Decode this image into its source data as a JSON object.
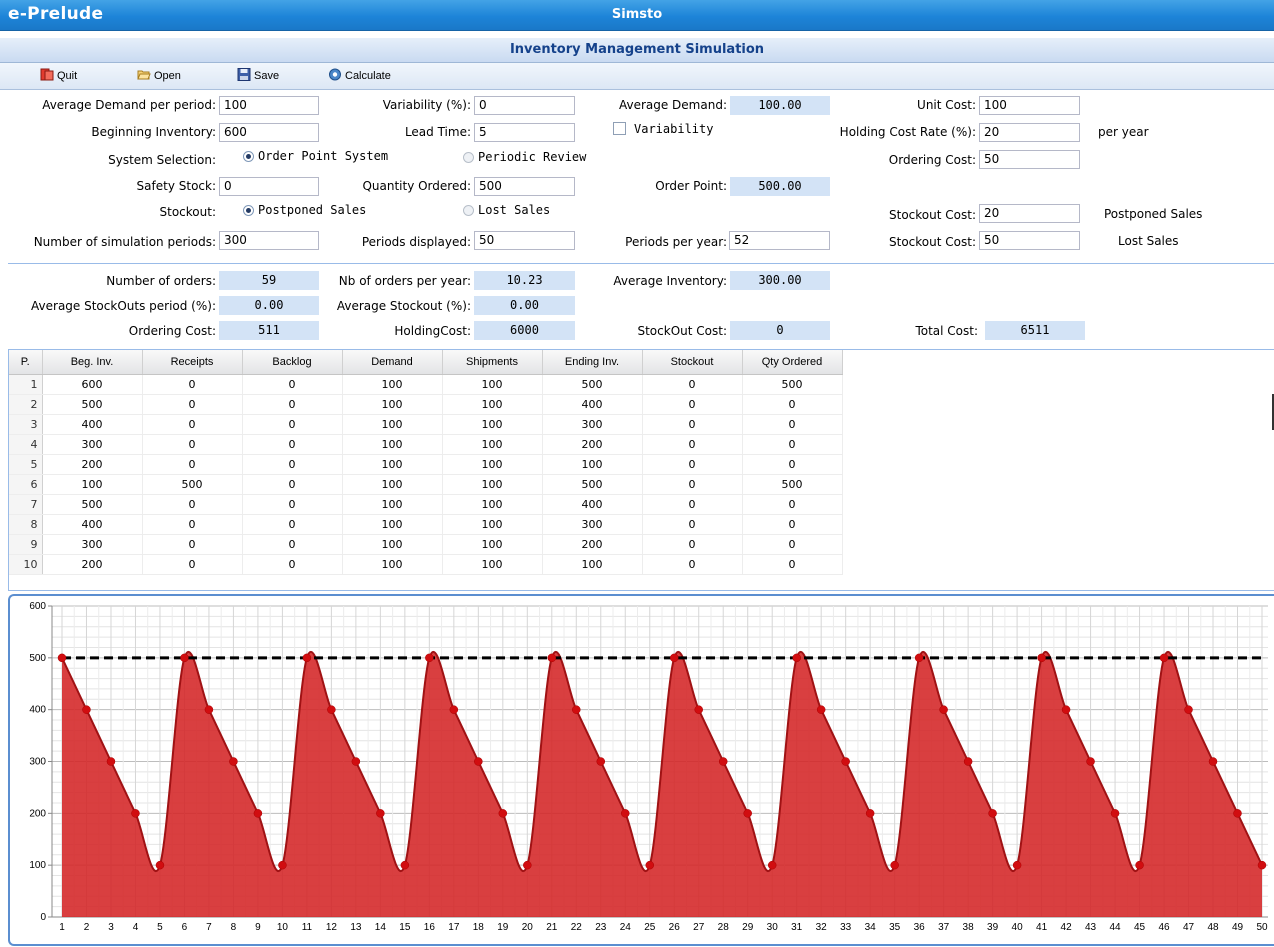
{
  "app": {
    "brand": "e-Prelude",
    "window_title": "Simsto",
    "subtitle": "Inventory Management Simulation"
  },
  "toolbar": {
    "quit": "Quit",
    "open": "Open",
    "save": "Save",
    "calculate": "Calculate"
  },
  "inputs": {
    "avg_demand_label": "Average Demand per period:",
    "avg_demand": "100",
    "variability_label": "Variability (%):",
    "variability": "0",
    "avg_demand_out_label": "Average Demand:",
    "avg_demand_out": "100.00",
    "unit_cost_label": "Unit Cost:",
    "unit_cost": "100",
    "beg_inv_label": "Beginning Inventory:",
    "beg_inv": "600",
    "lead_time_label": "Lead Time:",
    "lead_time": "5",
    "variability_check_label": "Variability",
    "holding_rate_label": "Holding Cost Rate (%):",
    "holding_rate": "20",
    "per_year": "per year",
    "system_label": "System Selection:",
    "order_point_system": "Order Point System",
    "periodic_review": "Periodic Review",
    "ordering_cost_label": "Ordering Cost:",
    "ordering_cost": "50",
    "safety_stock_label": "Safety Stock:",
    "safety_stock": "0",
    "qty_ordered_label": "Quantity Ordered:",
    "qty_ordered": "500",
    "order_point_label": "Order Point:",
    "order_point": "500.00",
    "stockout_label": "Stockout:",
    "postponed_sales": "Postponed Sales",
    "lost_sales": "Lost Sales",
    "stockout_cost_label": "Stockout Cost:",
    "stockout_cost_postponed": "20",
    "postponed_sales_note": "Postponed Sales",
    "num_periods_label": "Number of simulation periods:",
    "num_periods": "300",
    "periods_displayed_label": "Periods displayed:",
    "periods_displayed": "50",
    "periods_per_year_label": "Periods per year:",
    "periods_per_year": "52",
    "stockout_cost_lost": "50",
    "lost_sales_note": "Lost Sales"
  },
  "results": {
    "num_orders_label": "Number of orders:",
    "num_orders": "59",
    "orders_per_year_label": "Nb of orders per year:",
    "orders_per_year": "10.23",
    "avg_inventory_label": "Average Inventory:",
    "avg_inventory": "300.00",
    "avg_stockouts_period_label": "Average StockOuts period (%):",
    "avg_stockouts_period": "0.00",
    "avg_stockout_label": "Average Stockout (%):",
    "avg_stockout": "0.00",
    "ordering_cost_label": "Ordering Cost:",
    "ordering_cost": "511",
    "holding_cost_label": "HoldingCost:",
    "holding_cost": "6000",
    "stockout_cost_label": "StockOut Cost:",
    "stockout_cost": "0",
    "total_cost_label": "Total Cost:",
    "total_cost": "6511"
  },
  "table": {
    "headers": [
      "P.",
      "Beg. Inv.",
      "Receipts",
      "Backlog",
      "Demand",
      "Shipments",
      "Ending Inv.",
      "Stockout",
      "Qty Ordered"
    ],
    "rows": [
      [
        "1",
        "600",
        "0",
        "0",
        "100",
        "100",
        "500",
        "0",
        "500"
      ],
      [
        "2",
        "500",
        "0",
        "0",
        "100",
        "100",
        "400",
        "0",
        "0"
      ],
      [
        "3",
        "400",
        "0",
        "0",
        "100",
        "100",
        "300",
        "0",
        "0"
      ],
      [
        "4",
        "300",
        "0",
        "0",
        "100",
        "100",
        "200",
        "0",
        "0"
      ],
      [
        "5",
        "200",
        "0",
        "0",
        "100",
        "100",
        "100",
        "0",
        "0"
      ],
      [
        "6",
        "100",
        "500",
        "0",
        "100",
        "100",
        "500",
        "0",
        "500"
      ],
      [
        "7",
        "500",
        "0",
        "0",
        "100",
        "100",
        "400",
        "0",
        "0"
      ],
      [
        "8",
        "400",
        "0",
        "0",
        "100",
        "100",
        "300",
        "0",
        "0"
      ],
      [
        "9",
        "300",
        "0",
        "0",
        "100",
        "100",
        "200",
        "0",
        "0"
      ],
      [
        "10",
        "200",
        "0",
        "0",
        "100",
        "100",
        "100",
        "0",
        "0"
      ]
    ]
  },
  "chart_data": {
    "type": "area",
    "x": [
      1,
      2,
      3,
      4,
      5,
      6,
      7,
      8,
      9,
      10,
      11,
      12,
      13,
      14,
      15,
      16,
      17,
      18,
      19,
      20,
      21,
      22,
      23,
      24,
      25,
      26,
      27,
      28,
      29,
      30,
      31,
      32,
      33,
      34,
      35,
      36,
      37,
      38,
      39,
      40,
      41,
      42,
      43,
      44,
      45,
      46,
      47,
      48,
      49,
      50
    ],
    "series": [
      {
        "values": [
          500,
          400,
          300,
          200,
          100,
          500,
          400,
          300,
          200,
          100,
          500,
          400,
          300,
          200,
          100,
          500,
          400,
          300,
          200,
          100,
          500,
          400,
          300,
          200,
          100,
          500,
          400,
          300,
          200,
          100,
          500,
          400,
          300,
          200,
          100,
          500,
          400,
          300,
          200,
          100,
          500,
          400,
          300,
          200,
          100,
          500,
          400,
          300,
          200,
          100
        ],
        "color": "#d42426"
      }
    ],
    "reference_line": {
      "value": 500,
      "color": "#000000",
      "style": "dashed"
    },
    "ylim": [
      0,
      600
    ],
    "yticks": [
      0,
      100,
      200,
      300,
      400,
      500,
      600
    ],
    "grid": true
  }
}
